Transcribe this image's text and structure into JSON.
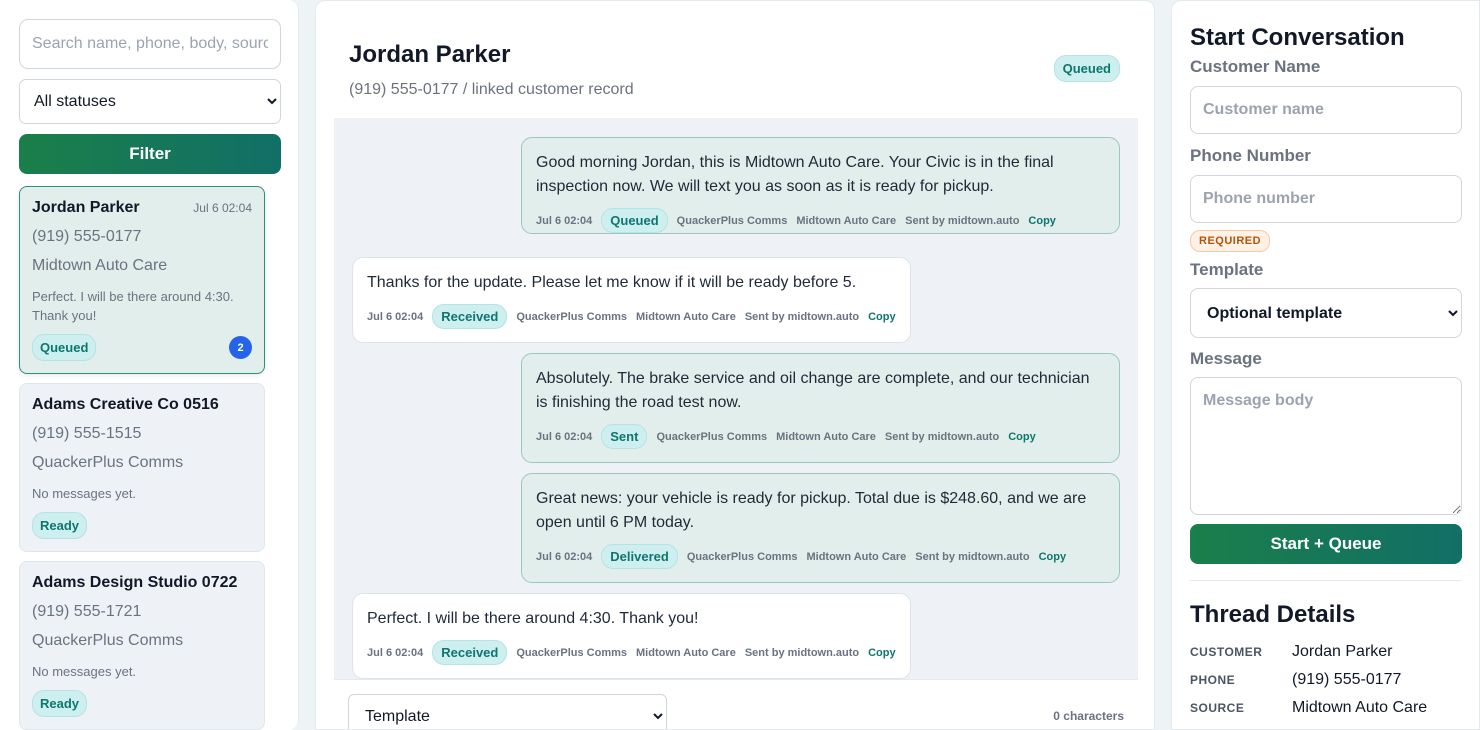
{
  "sidebar": {
    "search_placeholder": "Search name, phone, body, source",
    "status_filter": {
      "selected": "All statuses",
      "options": [
        "All statuses"
      ]
    },
    "filter_label": "Filter",
    "conversations": [
      {
        "name": "Jordan Parker",
        "date": "Jul 6 02:04",
        "phone": "(919) 555-0177",
        "source": "Midtown Auto Care",
        "preview": "Perfect. I will be there around 4:30. Thank you!",
        "status": "Queued",
        "unread": "2"
      },
      {
        "name": "Adams Creative Co 0516",
        "date": "",
        "phone": "(919) 555-1515",
        "source": "QuackerPlus Comms",
        "preview": "No messages yet.",
        "status": "Ready",
        "unread": ""
      },
      {
        "name": "Adams Design Studio 0722",
        "date": "",
        "phone": "(919) 555-1721",
        "source": "QuackerPlus Comms",
        "preview": "No messages yet.",
        "status": "Ready",
        "unread": ""
      }
    ]
  },
  "thread": {
    "title": "Jordan Parker",
    "subtitle": "(919) 555-0177 / linked customer record",
    "status": "Queued",
    "messages": [
      {
        "direction": "out",
        "body": "Good morning Jordan, this is Midtown Auto Care. Your Civic is in the final inspection now. We will text you as soon as it is ready for pickup.",
        "time": "Jul 6 02:04",
        "status": "Queued",
        "channel": "QuackerPlus Comms",
        "source": "Midtown Auto Care",
        "sender": "Sent by midtown.auto",
        "copy": "Copy"
      },
      {
        "direction": "in",
        "body": "Thanks for the update. Please let me know if it will be ready before 5.",
        "time": "Jul 6 02:04",
        "status": "Received",
        "channel": "QuackerPlus Comms",
        "source": "Midtown Auto Care",
        "sender": "Sent by midtown.auto",
        "copy": "Copy"
      },
      {
        "direction": "out",
        "body": "Absolutely. The brake service and oil change are complete, and our technician is finishing the road test now.",
        "time": "Jul 6 02:04",
        "status": "Sent",
        "channel": "QuackerPlus Comms",
        "source": "Midtown Auto Care",
        "sender": "Sent by midtown.auto",
        "copy": "Copy"
      },
      {
        "direction": "out",
        "body": "Great news: your vehicle is ready for pickup. Total due is $248.60, and we are open until 6 PM today.",
        "time": "Jul 6 02:04",
        "status": "Delivered",
        "channel": "QuackerPlus Comms",
        "source": "Midtown Auto Care",
        "sender": "Sent by midtown.auto",
        "copy": "Copy"
      },
      {
        "direction": "in",
        "body": "Perfect. I will be there around 4:30. Thank you!",
        "time": "Jul 6 02:04",
        "status": "Received",
        "channel": "QuackerPlus Comms",
        "source": "Midtown Auto Care",
        "sender": "Sent by midtown.auto",
        "copy": "Copy"
      }
    ],
    "composer": {
      "template_selected": "Template",
      "char_count": "0 characters"
    }
  },
  "start": {
    "title": "Start Conversation",
    "customer_label": "Customer Name",
    "customer_placeholder": "Customer name",
    "phone_label": "Phone Number",
    "phone_placeholder": "Phone number",
    "required": "REQUIRED",
    "template_label": "Template",
    "template_selected": "Optional template",
    "message_label": "Message",
    "message_placeholder": "Message body",
    "submit_label": "Start + Queue"
  },
  "details": {
    "title": "Thread Details",
    "rows": [
      {
        "key": "CUSTOMER",
        "value": "Jordan Parker"
      },
      {
        "key": "PHONE",
        "value": "(919) 555-0177"
      },
      {
        "key": "SOURCE",
        "value": "Midtown Auto Care"
      }
    ]
  },
  "colors": {
    "accent": "#1a7f4a",
    "accent2": "#116f66",
    "badge": "#2563eb",
    "pill_bg": "#cdeff0",
    "pill_text": "#0f766e"
  }
}
